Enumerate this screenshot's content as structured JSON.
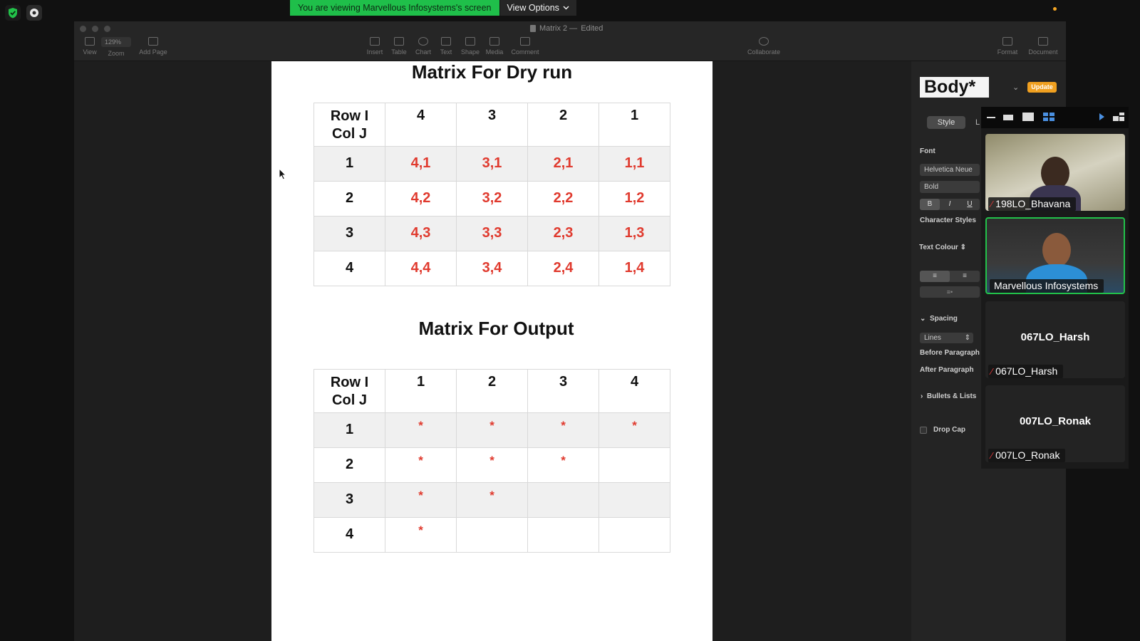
{
  "banner": {
    "message": "You are viewing Marvellous Infosystems's screen",
    "view_options": "View Options"
  },
  "window": {
    "title": "Matrix 2 —",
    "edited": "Edited",
    "zoom": "129%",
    "toolbar": [
      {
        "label": "View",
        "icon": "sidebar-icon"
      },
      {
        "label": "Zoom",
        "icon": "zoom-icon"
      },
      {
        "label": "Add Page",
        "icon": "add-page-icon"
      },
      {
        "label": "Insert",
        "icon": "paragraph-icon"
      },
      {
        "label": "Table",
        "icon": "table-icon"
      },
      {
        "label": "Chart",
        "icon": "chart-icon"
      },
      {
        "label": "Text",
        "icon": "text-icon"
      },
      {
        "label": "Shape",
        "icon": "shape-icon"
      },
      {
        "label": "Media",
        "icon": "media-icon"
      },
      {
        "label": "Comment",
        "icon": "comment-icon"
      },
      {
        "label": "Collaborate",
        "icon": "collaborate-icon"
      },
      {
        "label": "Format",
        "icon": "brush-icon"
      },
      {
        "label": "Document",
        "icon": "document-icon"
      }
    ]
  },
  "document": {
    "heading1": "Matrix For Dry run",
    "heading2": "Matrix For Output",
    "dry_run": {
      "header": [
        "Row  I",
        "Col J",
        "4",
        "3",
        "2",
        "1"
      ],
      "rows": [
        [
          "1",
          "4,1",
          "3,1",
          "2,1",
          "1,1"
        ],
        [
          "2",
          "4,2",
          "3,2",
          "2,2",
          "1,2"
        ],
        [
          "3",
          "4,3",
          "3,3",
          "2,3",
          "1,3"
        ],
        [
          "4",
          "4,4",
          "3,4",
          "2,4",
          "1,4"
        ]
      ]
    },
    "output": {
      "header": [
        "Row  I",
        "Col J",
        "1",
        "2",
        "3",
        "4"
      ],
      "rows": [
        [
          "1",
          "*",
          "*",
          "*",
          "*"
        ],
        [
          "2",
          "*",
          "*",
          "*",
          ""
        ],
        [
          "3",
          "*",
          "*",
          "",
          ""
        ],
        [
          "4",
          "*",
          "",
          "",
          ""
        ]
      ]
    }
  },
  "sidebar": {
    "style_name": "Body*",
    "update": "Update",
    "tab_style": "Style",
    "tab_layout": "L",
    "font_label": "Font",
    "font_family": "Helvetica Neue",
    "font_weight": "Bold",
    "bold": "B",
    "italic": "I",
    "underline": "U",
    "character_styles": "Character Styles",
    "text_colour": "Text Colour",
    "spacing": "Spacing",
    "lines": "Lines",
    "before_paragraph": "Before Paragraph",
    "after_paragraph": "After Paragraph",
    "bullets": "Bullets & Lists",
    "drop_cap": "Drop Cap"
  },
  "participants": [
    {
      "name": "198LO_Bhavana",
      "muted": true,
      "video": true
    },
    {
      "name": "Marvellous Infosystems",
      "muted": false,
      "video": true,
      "active_speaker": true
    },
    {
      "name": "067LO_Harsh",
      "muted": true,
      "video": false
    },
    {
      "name": "007LO_Ronak",
      "muted": true,
      "video": false
    }
  ],
  "colors": {
    "banner_green": "#1fbf4a",
    "accent_red": "#e03a2e",
    "speaker_border": "#22c24a",
    "update_orange": "#f0a020"
  }
}
